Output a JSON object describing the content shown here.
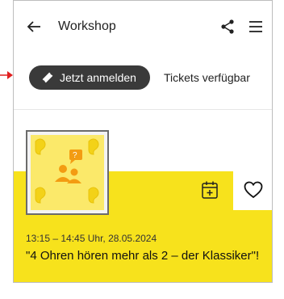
{
  "header": {
    "title": "Workshop",
    "back_icon": "arrow-left-icon",
    "share_icon": "share-icon",
    "menu_icon": "hamburger-menu-icon"
  },
  "actions": {
    "register_label": "Jetzt anmelden",
    "register_icon": "ticket-icon",
    "tickets_status": "Tickets verfügbar"
  },
  "event": {
    "datetime": "13:15 – 14:45 Uhr, 28.05.2024",
    "title": "\"4 Ohren hören mehr als 2 – der Klassiker\"!",
    "thumbnail": "four-ears-discussion-illustration",
    "calendar_icon": "calendar-add-icon",
    "favorite_icon": "heart-icon"
  },
  "colors": {
    "accent_yellow": "#f7e21c",
    "button_dark": "#3a3a3a",
    "annotation_arrow": "#e02020"
  }
}
